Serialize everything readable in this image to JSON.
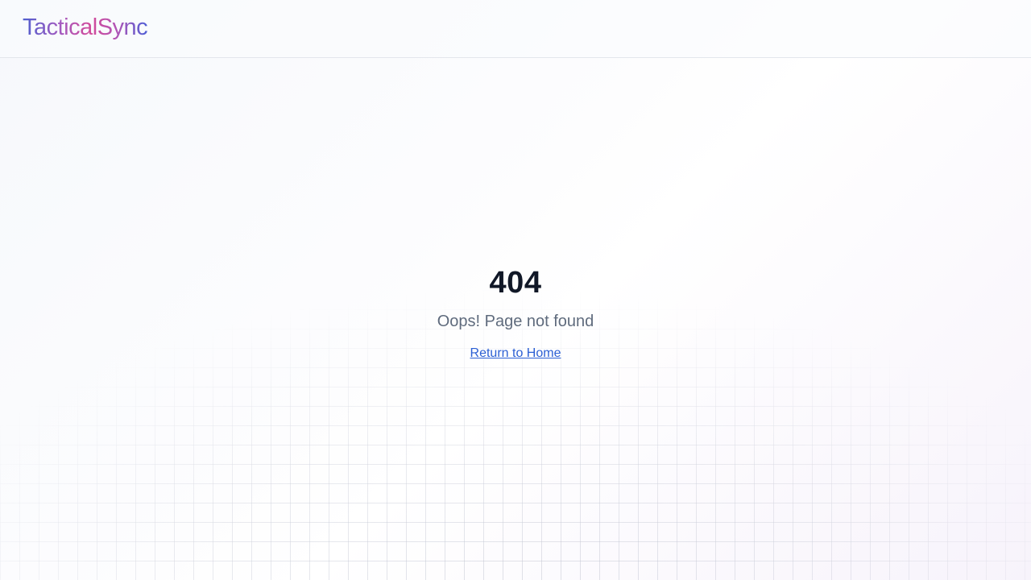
{
  "header": {
    "logo_text": "TacticalSync"
  },
  "error": {
    "code": "404",
    "message": "Oops! Page not found",
    "home_link_label": "Return to Home"
  },
  "colors": {
    "code_text": "#111827",
    "message_text": "#5f6b7d",
    "link": "#2b5fd4",
    "logo_gradient": [
      "#4f5fcf",
      "#d24a9a",
      "#4f5fd6"
    ]
  }
}
